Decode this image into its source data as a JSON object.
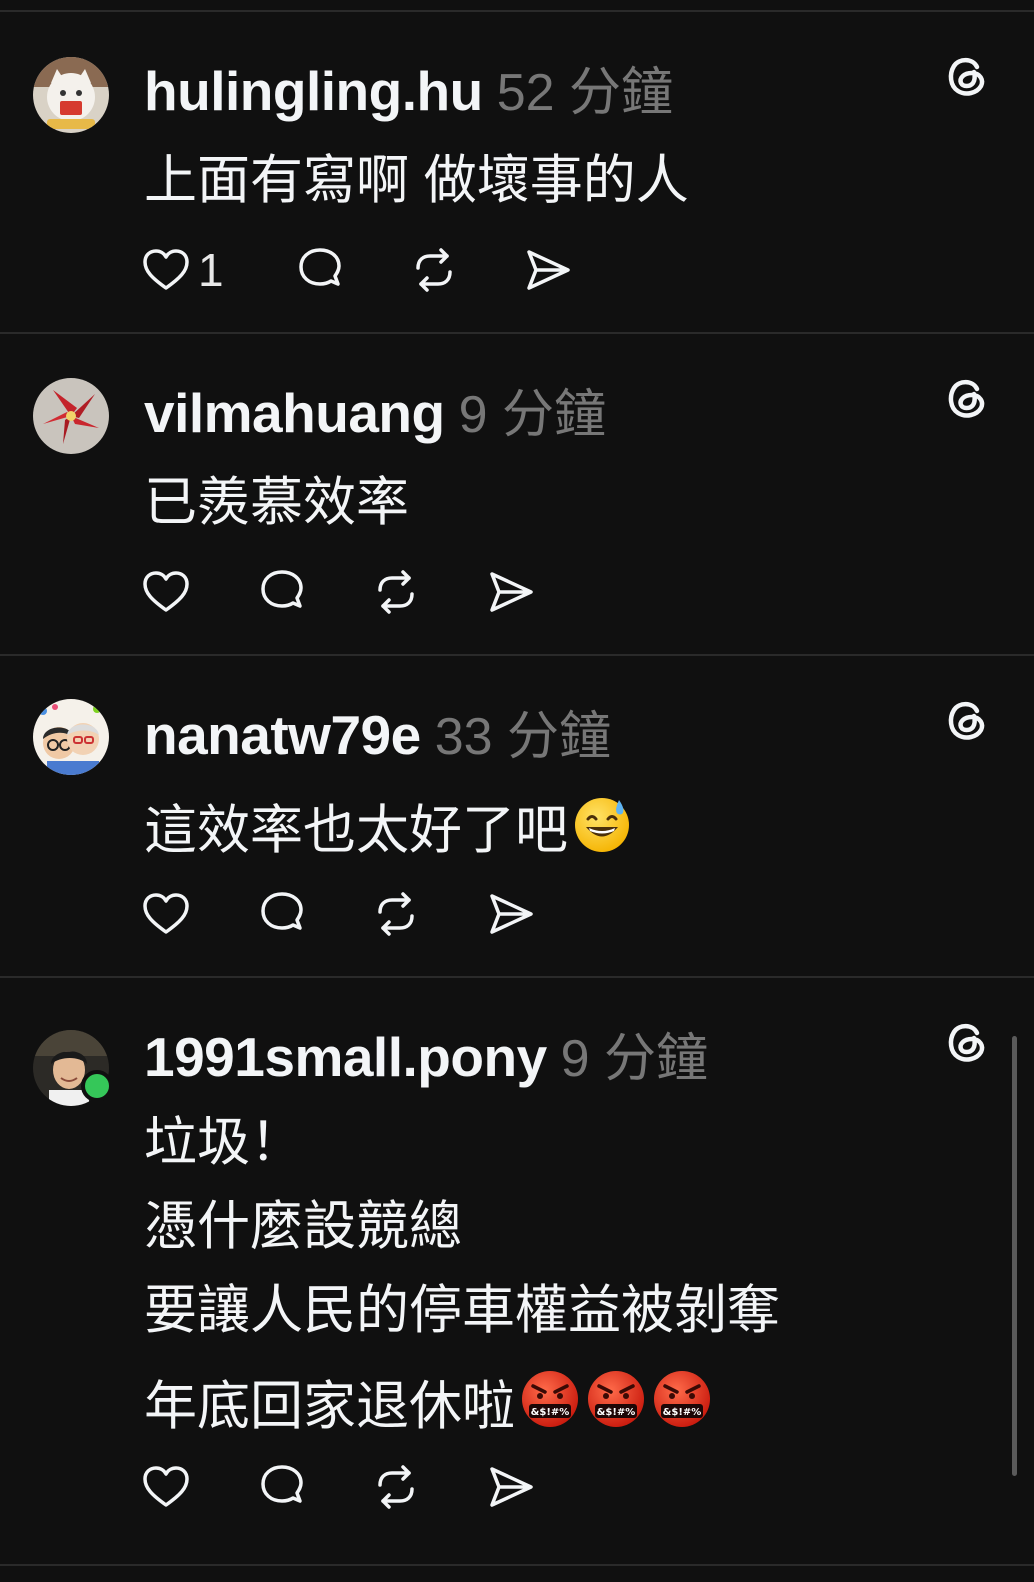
{
  "posts": [
    {
      "username": "hulingling.hu",
      "time": "52 分鐘",
      "lines": [
        "上面有寫啊 做壞事的人"
      ],
      "like_count": "1",
      "online": false
    },
    {
      "username": "vilmahuang",
      "time": "9 分鐘",
      "lines": [
        "已羨慕效率"
      ],
      "like_count": "",
      "online": false
    },
    {
      "username": "nanatw79e",
      "time": "33 分鐘",
      "lines": [
        "這效率也太好了吧"
      ],
      "emojis": [
        "grinning-sweat-emoji"
      ],
      "like_count": "",
      "online": false
    },
    {
      "username": "1991small.pony",
      "time": "9 分鐘",
      "lines": [
        "垃圾！",
        "憑什麼設競總",
        "要讓人民的停車權益被剝奪",
        "年底回家退休啦"
      ],
      "emojis": [
        "cursing-face-emoji",
        "cursing-face-emoji",
        "cursing-face-emoji"
      ],
      "like_count": "",
      "online": true
    }
  ],
  "icons": {
    "brand": "threads-logo-icon",
    "like": "heart-icon",
    "reply": "comment-bubble-icon",
    "repost": "repost-icon",
    "share": "send-icon"
  },
  "colors": {
    "background": "#101010",
    "text": "#f3f5f7",
    "muted": "#777777",
    "divider": "#2a2a2a",
    "online": "#35c759"
  }
}
